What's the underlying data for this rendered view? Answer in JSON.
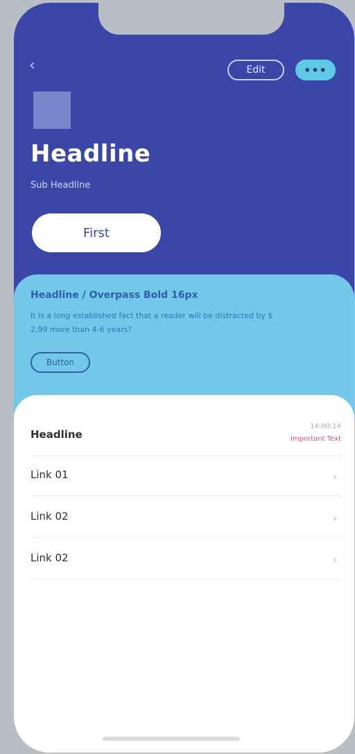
{
  "header": {
    "back_icon": "‹",
    "edit_label": "Edit",
    "more_label": "•••",
    "headline": "Headline",
    "subheadline": "Sub Headline",
    "first_button_label": "First"
  },
  "info_card": {
    "title": "Headline / Overpass Bold 16px",
    "text": "It is a long established fact that a reader will be distracted by $ 2,99 more than 4-6 years?",
    "button_label": "Button"
  },
  "list": {
    "header_label": "Headline",
    "header_time": "14:00:14",
    "header_important": "Important Text",
    "items": [
      {
        "label": "Link 01"
      },
      {
        "label": "Link 02"
      },
      {
        "label": "Link 02"
      }
    ]
  },
  "colors": {
    "hero_bg": "#3a47a8",
    "card_bg": "#73c8ea",
    "accent_cyan": "#5ecbe6",
    "important_red": "#e44c6b"
  },
  "icons": {
    "back": "chevron-left-icon",
    "row_chevron": "chevron-right-icon",
    "more": "more-dots-icon"
  }
}
